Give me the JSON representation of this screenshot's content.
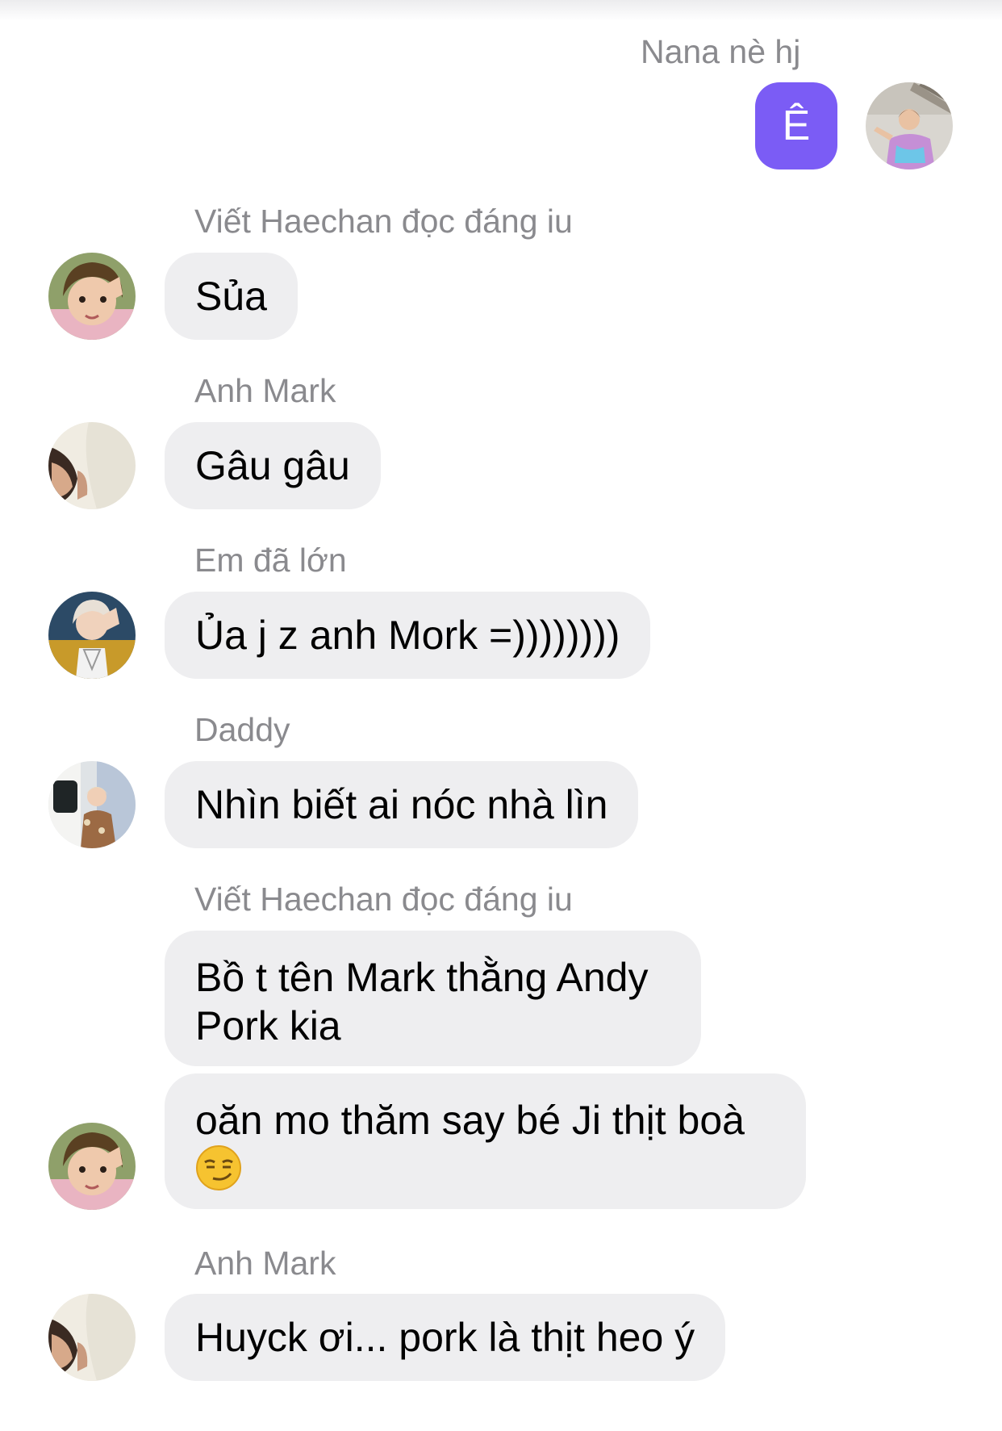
{
  "messages": [
    {
      "sender": "Nana nè hj",
      "text": "Ê",
      "outgoing": true
    },
    {
      "sender": "Viết Haechan đọc đáng iu",
      "text": "Sủa"
    },
    {
      "sender": "Anh Mark",
      "text": "Gâu gâu"
    },
    {
      "sender": "Em đã lớn",
      "text": "Ủa j z anh Mork =))))))))"
    },
    {
      "sender": "Daddy",
      "text": "Nhìn biết ai nóc nhà lìn"
    },
    {
      "sender": "Viết Haechan đọc đáng iu",
      "text": "Bồ t tên Mark thằng Andy Pork kia"
    },
    {
      "text": " oăn mo thăm say bé Ji thịt boà",
      "emoji": "smirking-face"
    },
    {
      "sender": "Anh Mark",
      "text": "Huyck ơi... pork là thịt heo ý"
    }
  ],
  "colors": {
    "outgoing_bubble": "#7b5cf5",
    "incoming_bubble": "#eeeef0",
    "sender_name": "#8a8a8e"
  }
}
